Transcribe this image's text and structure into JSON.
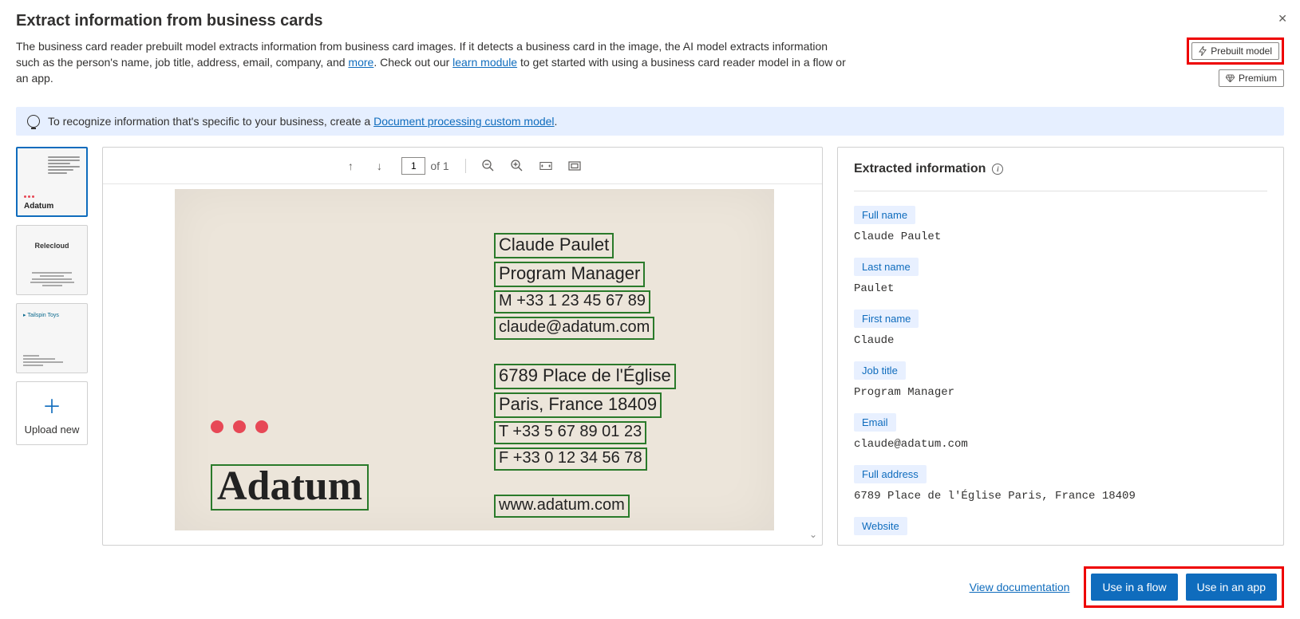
{
  "header": {
    "title": "Extract information from business cards",
    "desc1": "The business card reader prebuilt model extracts information from business card images. If it detects a business card in the image, the AI model extracts information such as the person's name, job title, address, email, company, and ",
    "more_link": "more",
    "desc2": ". Check out our ",
    "learn_link": "learn module",
    "desc3": " to get started with using a business card reader model in a flow or an app."
  },
  "badges": {
    "prebuilt": "Prebuilt model",
    "premium": "Premium"
  },
  "tip": {
    "text1": "To recognize information that's specific to your business, create a ",
    "link": "Document processing custom model",
    "text2": "."
  },
  "thumbs": {
    "t1_logo": "Adatum",
    "t2_logo": "Relecloud",
    "t3_logo": "Tailspin Toys",
    "upload": "Upload new"
  },
  "toolbar": {
    "page_current": "1",
    "page_total": "of 1"
  },
  "card": {
    "logo_text": "Adatum",
    "lines": {
      "name": "Claude Paulet",
      "title": "Program Manager",
      "mobile": "M +33 1 23 45 67 89",
      "email": "claude@adatum.com",
      "addr1": "6789 Place de l'Église",
      "addr2": "Paris, France 18409",
      "tel": "T +33 5 67 89 01 23",
      "fax": "F +33 0 12 34 56 78",
      "web": "www.adatum.com"
    }
  },
  "results": {
    "heading": "Extracted information",
    "fields": [
      {
        "label": "Full name",
        "value": "Claude Paulet"
      },
      {
        "label": "Last name",
        "value": "Paulet"
      },
      {
        "label": "First name",
        "value": "Claude"
      },
      {
        "label": "Job title",
        "value": "Program Manager"
      },
      {
        "label": "Email",
        "value": "claude@adatum.com"
      },
      {
        "label": "Full address",
        "value": "6789 Place de l'Église Paris, France 18409"
      },
      {
        "label": "Website",
        "value": ""
      }
    ]
  },
  "footer": {
    "doc_link": "View documentation",
    "flow_btn": "Use in a flow",
    "app_btn": "Use in an app"
  }
}
